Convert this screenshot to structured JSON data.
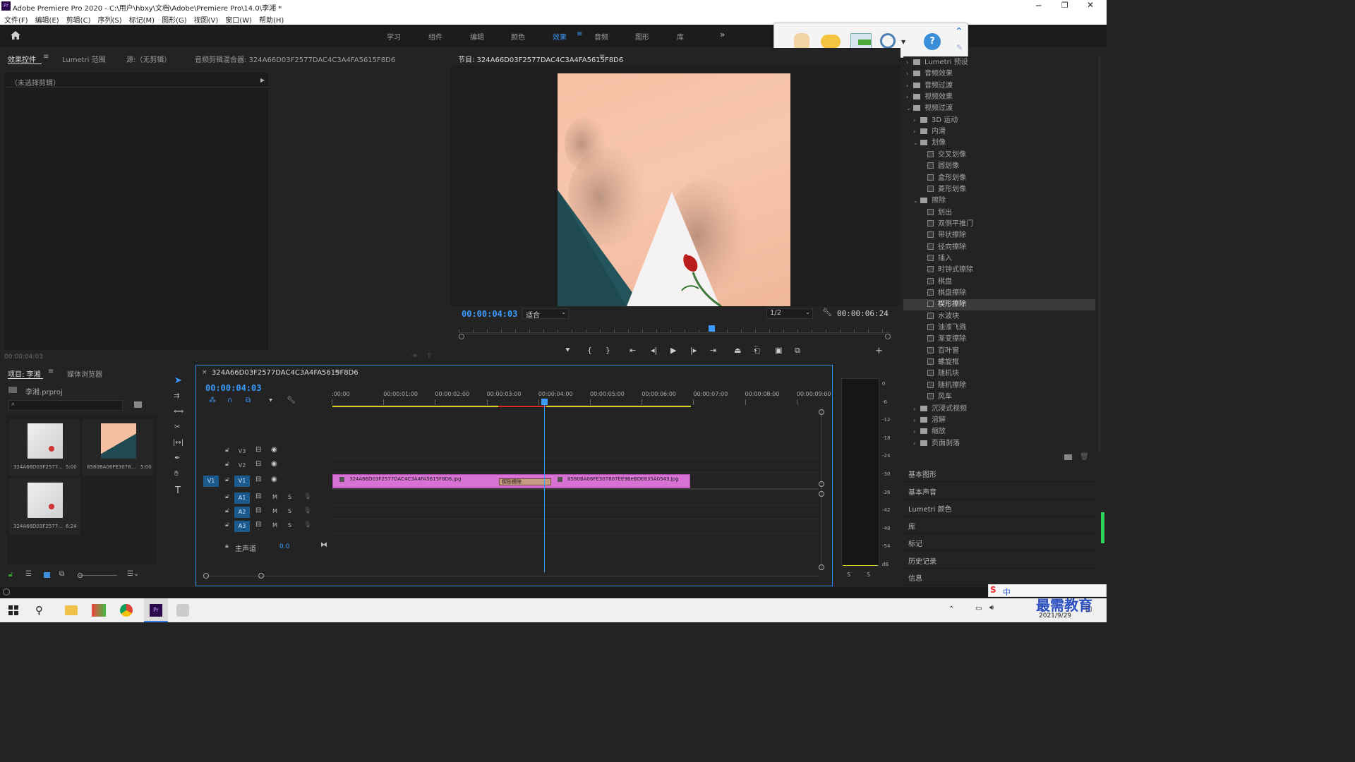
{
  "app": {
    "title": "Adobe Premiere Pro 2020 - C:\\用户\\hbxy\\文档\\Adobe\\Premiere Pro\\14.0\\李湘 *",
    "logo": "Pr"
  },
  "menu": [
    "文件(F)",
    "编辑(E)",
    "剪辑(C)",
    "序列(S)",
    "标记(M)",
    "图形(G)",
    "视图(V)",
    "窗口(W)",
    "帮助(H)"
  ],
  "workspaces": [
    "学习",
    "组件",
    "编辑",
    "颜色",
    "效果",
    "音频",
    "图形",
    "库"
  ],
  "active_workspace": "效果",
  "source_panel": {
    "tabs": [
      "效果控件",
      "Lumetri 范围",
      "源:（无剪辑）",
      "音频剪辑混合器: 324A66D03F2577DAC4C3A4FA5615F8D6"
    ],
    "no_clip": "（未选择剪辑）",
    "timecode": "00:00:04:03"
  },
  "program": {
    "title": "节目: 324A66D03F2577DAC4C3A4FA5615F8D6",
    "timecode": "00:00:04:03",
    "fit": "适合",
    "resolution": "1/2",
    "duration": "00:00:06:24"
  },
  "effects_tree": [
    {
      "label": "Lumetri 预设",
      "level": 0,
      "type": "folder"
    },
    {
      "label": "音频效果",
      "level": 0,
      "type": "folder"
    },
    {
      "label": "音频过渡",
      "level": 0,
      "type": "folder"
    },
    {
      "label": "视频效果",
      "level": 0,
      "type": "folder"
    },
    {
      "label": "视频过渡",
      "level": 0,
      "type": "folder",
      "open": true
    },
    {
      "label": "3D 运动",
      "level": 1,
      "type": "folder"
    },
    {
      "label": "内滑",
      "level": 1,
      "type": "folder"
    },
    {
      "label": "划像",
      "level": 1,
      "type": "folder",
      "open": true
    },
    {
      "label": "交叉划像",
      "level": 2,
      "type": "fx"
    },
    {
      "label": "圆划像",
      "level": 2,
      "type": "fx"
    },
    {
      "label": "盒形划像",
      "level": 2,
      "type": "fx"
    },
    {
      "label": "菱形划像",
      "level": 2,
      "type": "fx"
    },
    {
      "label": "擦除",
      "level": 1,
      "type": "folder",
      "open": true
    },
    {
      "label": "划出",
      "level": 2,
      "type": "fx"
    },
    {
      "label": "双侧平推门",
      "level": 2,
      "type": "fx"
    },
    {
      "label": "带状擦除",
      "level": 2,
      "type": "fx"
    },
    {
      "label": "径向擦除",
      "level": 2,
      "type": "fx"
    },
    {
      "label": "插入",
      "level": 2,
      "type": "fx"
    },
    {
      "label": "时钟式擦除",
      "level": 2,
      "type": "fx"
    },
    {
      "label": "棋盘",
      "level": 2,
      "type": "fx"
    },
    {
      "label": "棋盘擦除",
      "level": 2,
      "type": "fx"
    },
    {
      "label": "楔形擦除",
      "level": 2,
      "type": "fx",
      "selected": true
    },
    {
      "label": "水波块",
      "level": 2,
      "type": "fx"
    },
    {
      "label": "油漆飞溅",
      "level": 2,
      "type": "fx"
    },
    {
      "label": "渐变擦除",
      "level": 2,
      "type": "fx"
    },
    {
      "label": "百叶窗",
      "level": 2,
      "type": "fx"
    },
    {
      "label": "螺旋框",
      "level": 2,
      "type": "fx"
    },
    {
      "label": "随机块",
      "level": 2,
      "type": "fx"
    },
    {
      "label": "随机擦除",
      "level": 2,
      "type": "fx"
    },
    {
      "label": "风车",
      "level": 2,
      "type": "fx"
    },
    {
      "label": "沉浸式视频",
      "level": 1,
      "type": "folder"
    },
    {
      "label": "溶解",
      "level": 1,
      "type": "folder"
    },
    {
      "label": "缩放",
      "level": 1,
      "type": "folder"
    },
    {
      "label": "页面剥落",
      "level": 1,
      "type": "folder"
    }
  ],
  "side_panels": [
    "基本图形",
    "基本声音",
    "Lumetri 颜色",
    "库",
    "标记",
    "历史记录",
    "信息"
  ],
  "project": {
    "tabs": [
      "项目: 李湘",
      "媒体浏览器"
    ],
    "file": "李湘.prproj",
    "items": [
      {
        "name": "324A66D03F2577...",
        "dur": "5:00"
      },
      {
        "name": "8580BA06FE3078...",
        "dur": "5:00"
      },
      {
        "name": "324A66D03F2577...",
        "dur": "6:24"
      }
    ]
  },
  "timeline": {
    "title": "324A66D03F2577DAC4C3A4FA5615F8D6",
    "timecode": "00:00:04:03",
    "ruler": [
      ":00:00",
      "00:00:01:00",
      "00:00:02:00",
      "00:00:03:00",
      "00:00:04:00",
      "00:00:05:00",
      "00:00:06:00",
      "00:00:07:00",
      "00:00:08:00",
      "00:00:09:00"
    ],
    "tracks": {
      "video": [
        "V3",
        "V2",
        "V1"
      ],
      "audio": [
        "A1",
        "A2",
        "A3"
      ],
      "master": "主声道",
      "master_val": "0.0",
      "source_patch": "V1",
      "mute": "M",
      "solo": "S"
    },
    "clips": [
      {
        "name": "324A66D03F2577DAC4C3A4FA5615F8D6.jpg"
      },
      {
        "name": "8580BA06FE307807EE9BeBDE835A0543.jpg"
      }
    ],
    "transition": "楔形擦除"
  },
  "meter": {
    "ticks": [
      "0",
      "-6",
      "-12",
      "-18",
      "-24",
      "-30",
      "-36",
      "-42",
      "-48",
      "-54",
      "dB"
    ],
    "solo": [
      "S",
      "S"
    ]
  },
  "taskbar": {
    "date": "2021/9/29",
    "watermark": "最需教育",
    "ime": "中"
  }
}
